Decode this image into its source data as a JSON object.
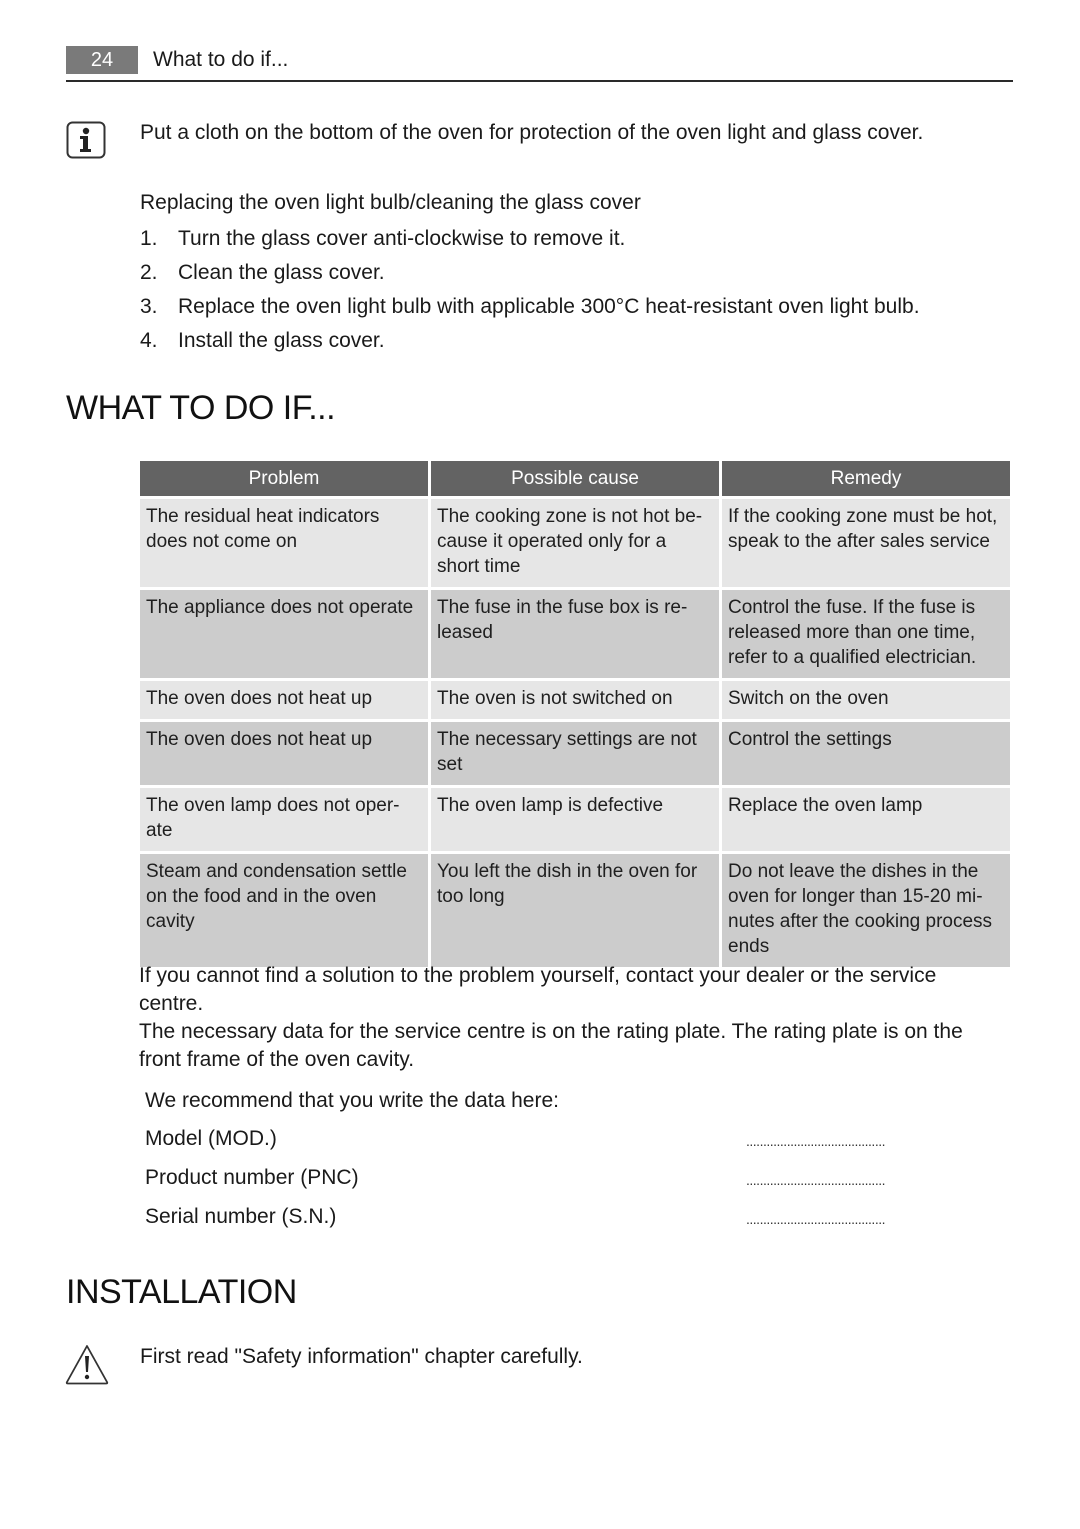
{
  "header": {
    "page_number": "24",
    "section_title": "What to do if..."
  },
  "note": {
    "icon": "info-icon",
    "text": "Put a cloth on the bottom of the oven for protection of the oven light and glass cover."
  },
  "procedure": {
    "title": "Replacing the oven light bulb/cleaning the glass cover",
    "steps": [
      {
        "num": "1.",
        "text": "Turn the glass cover anti-clockwise to remove it."
      },
      {
        "num": "2.",
        "text": "Clean the glass cover."
      },
      {
        "num": "3.",
        "text": "Replace the oven light bulb with applicable 300°C heat-resistant oven light bulb."
      },
      {
        "num": "4.",
        "text": "Install the glass cover."
      }
    ]
  },
  "what_to_do": {
    "heading": "WHAT TO DO IF...",
    "table": {
      "headers": [
        "Problem",
        "Possible cause",
        "Remedy"
      ],
      "rows": [
        {
          "problem": "The residual heat indicators does not come on",
          "cause": "The cooking zone is not hot be- cause it operated only for a short time",
          "remedy": "If the cooking zone must be hot, speak to the after sales service"
        },
        {
          "problem": "The appliance does not operate",
          "cause": "The fuse in the fuse box is re- leased",
          "remedy": "Control the fuse. If the fuse is released more than one time, refer to a qualified electrician."
        },
        {
          "problem": "The oven does not heat up",
          "cause": "The oven is not switched on",
          "remedy": "Switch on the oven"
        },
        {
          "problem": "The oven does not heat up",
          "cause": "The necessary settings are not set",
          "remedy": "Control the settings"
        },
        {
          "problem": "The oven lamp does not oper- ate",
          "cause": "The oven lamp is defective",
          "remedy": "Replace the oven lamp"
        },
        {
          "problem": "Steam and condensation settle on the food and in the oven cavity",
          "cause": "You left the dish in the oven for too long",
          "remedy": "Do not leave the dishes in the oven for longer than 15-20 mi- nutes after the cooking process ends"
        }
      ]
    },
    "paragraph_1": "If you cannot find a solution to the problem yourself, contact your dealer or the service centre.",
    "paragraph_2": "The necessary data for the service centre is on the rating plate. The rating plate is on the front frame of the oven cavity.",
    "recommend": "We recommend that you write the data here:",
    "fields": [
      {
        "label": "Model (MOD.)",
        "value": "........................................."
      },
      {
        "label": "Product number (PNC)",
        "value": "........................................."
      },
      {
        "label": "Serial number (S.N.)",
        "value": "........................................."
      }
    ]
  },
  "installation": {
    "heading": "INSTALLATION",
    "warning_icon": "warning-icon",
    "warning_text": "First read \"Safety information\" chapter carefully."
  }
}
